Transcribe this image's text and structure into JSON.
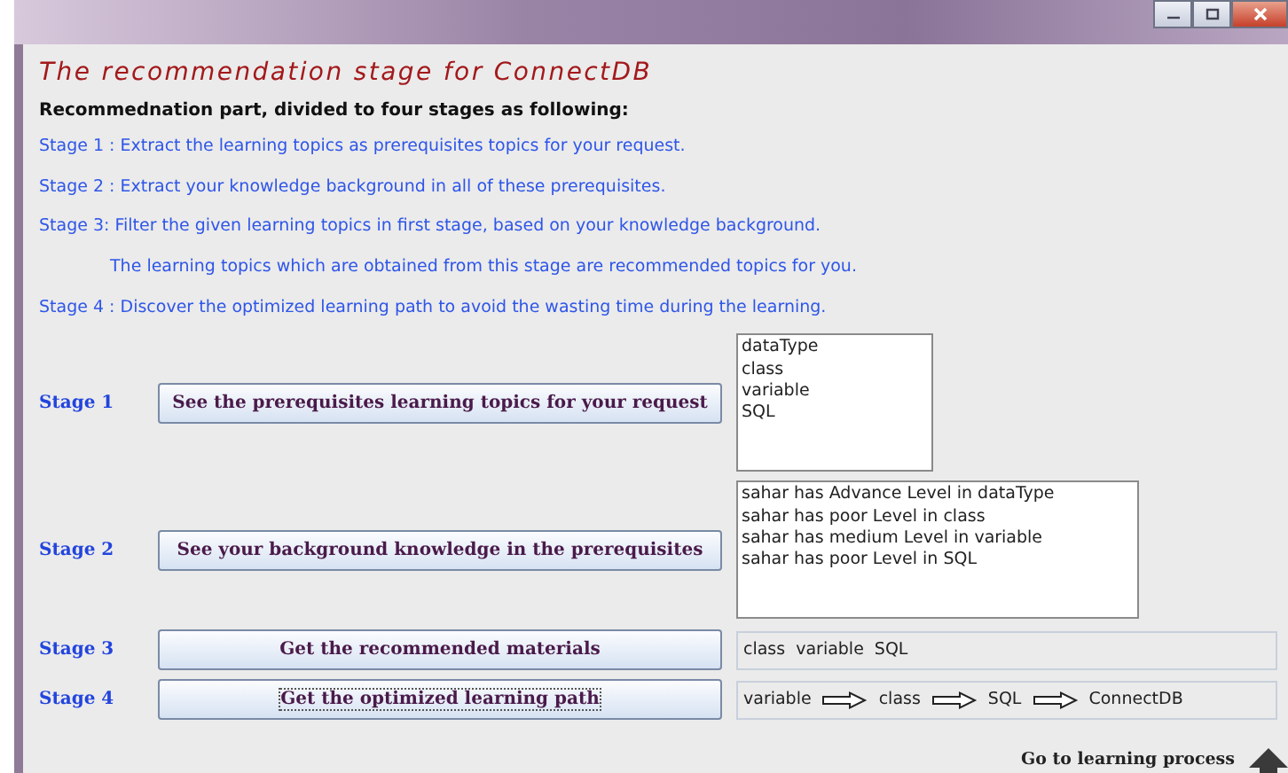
{
  "heading": "The recommendation stage for ConnectDB",
  "intro": "Recommednation part, divided to four stages as following:",
  "descriptions": [
    {
      "text": "Stage 1 :  Extract the learning topics as prerequisites topics  for your request.",
      "indented": false
    },
    {
      "text": "Stage 2 : Extract your knowledge background in all of these prerequisites.",
      "indented": false
    },
    {
      "text": "Stage 3: Filter the given learning topics in first stage, based on your knowledge background.",
      "indented": false
    },
    {
      "text": "The learning topics which are obtained from this stage are recommended topics for you.",
      "indented": true
    },
    {
      "text": "Stage 4 : Discover the optimized learning path to avoid the wasting time during the learning.",
      "indented": false
    }
  ],
  "stages": [
    {
      "label": "Stage 1",
      "button": "See the prerequisites learning topics for your request",
      "kind": "list",
      "items": [
        "dataType",
        "class",
        "variable",
        "SQL"
      ]
    },
    {
      "label": "Stage 2",
      "button": "See your background knowledge in the prerequisites",
      "kind": "widelist",
      "items": [
        "sahar has Advance Level in dataType",
        "sahar has poor Level in class",
        "sahar has medium Level in variable",
        "sahar has poor Level in SQL"
      ]
    },
    {
      "label": "Stage 3",
      "button": "Get the recommended materials",
      "kind": "field",
      "items": [
        "class",
        "variable",
        "SQL"
      ]
    },
    {
      "label": "Stage 4",
      "button": "Get the optimized learning path",
      "kind": "path",
      "items": [
        "variable",
        "class",
        "SQL",
        "ConnectDB"
      ],
      "focused": true
    }
  ],
  "footer": {
    "link": "Go to learning process"
  }
}
